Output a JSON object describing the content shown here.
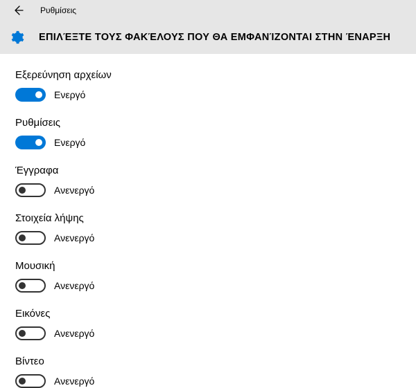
{
  "header": {
    "app_title": "Ρυθμίσεις",
    "page_title": "ΕΠΙΛΈΞΤΕ ΤΟΥΣ ΦΑΚΈΛΟΥΣ ΠΟΥ ΘΑ ΕΜΦΑΝΊΖΟΝΤΑΙ ΣΤΗΝ ΈΝΑΡΞΗ"
  },
  "labels": {
    "on": "Ενεργό",
    "off": "Ανενεργό"
  },
  "settings": [
    {
      "name": "Εξερεύνηση αρχείων",
      "enabled": true
    },
    {
      "name": "Ρυθμίσεις",
      "enabled": true
    },
    {
      "name": "Έγγραφα",
      "enabled": false
    },
    {
      "name": "Στοιχεία λήψης",
      "enabled": false
    },
    {
      "name": "Μουσική",
      "enabled": false
    },
    {
      "name": "Εικόνες",
      "enabled": false
    },
    {
      "name": "Βίντεο",
      "enabled": false
    }
  ],
  "colors": {
    "accent": "#0078d7",
    "header_bg": "#e6e6e6"
  }
}
